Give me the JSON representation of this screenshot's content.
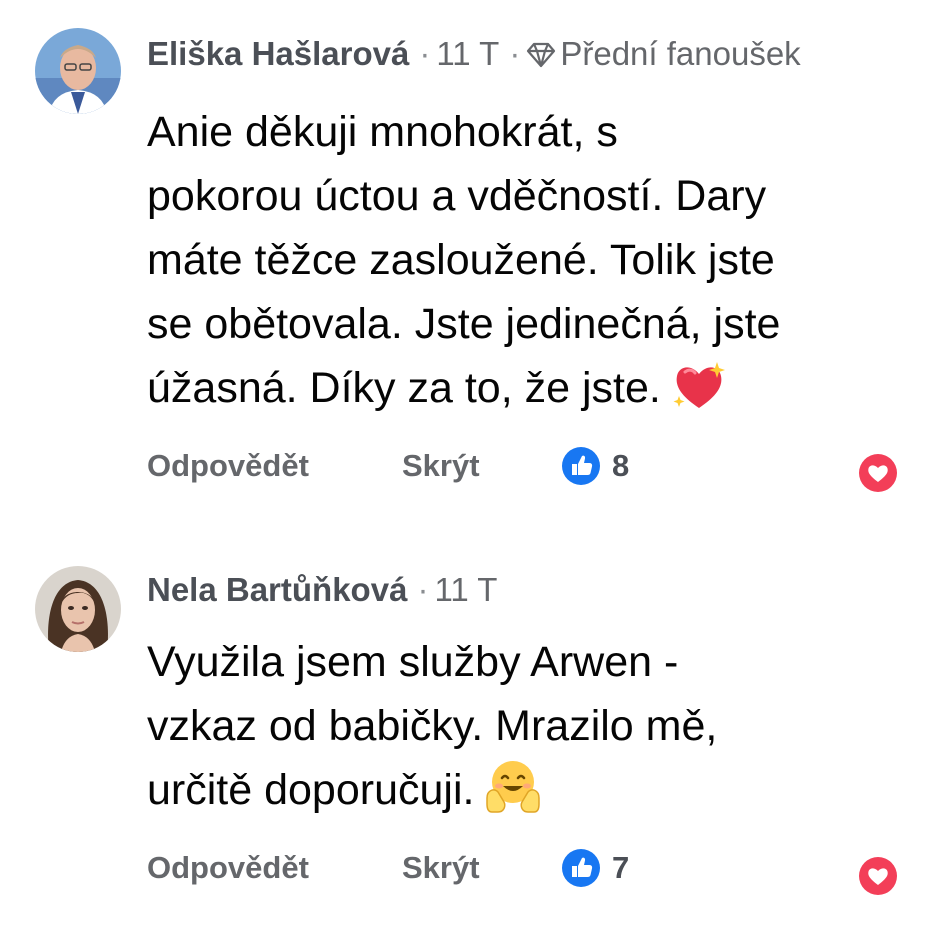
{
  "comments": [
    {
      "author": "Eliška Hašlarová",
      "time": "11 T",
      "badge_icon": "diamond-icon",
      "badge": "Přední fanoušek",
      "text_lines": [
        "Anie děkuji mnohokrát, s",
        "pokorou úctou a vděčností. Dary",
        "máte těžce zasloužené. Tolik jste",
        "se obětovala. Jste jedinečná, jste",
        "úžasná. Díky za to, že jste."
      ],
      "emoji": "sparkling-heart-emoji",
      "reply_label": "Odpovědět",
      "hide_label": "Skrýt",
      "like_count": "8"
    },
    {
      "author": "Nela Bartůňková",
      "time": "11 T",
      "text_lines": [
        "Využila jsem služby Arwen -",
        "vzkaz od babičky. Mrazilo mě,",
        "určitě doporučuji."
      ],
      "emoji": "hugging-face-emoji",
      "reply_label": "Odpovědět",
      "hide_label": "Skrýt",
      "like_count": "7"
    }
  ],
  "icons": {
    "like": "thumbs-up-icon",
    "react": "heart-react-icon"
  },
  "colors": {
    "like_blue": "#1877f2",
    "heart_red": "#f33e58",
    "secondary_text": "#65676b",
    "body_text": "#050505"
  },
  "separator": "·"
}
